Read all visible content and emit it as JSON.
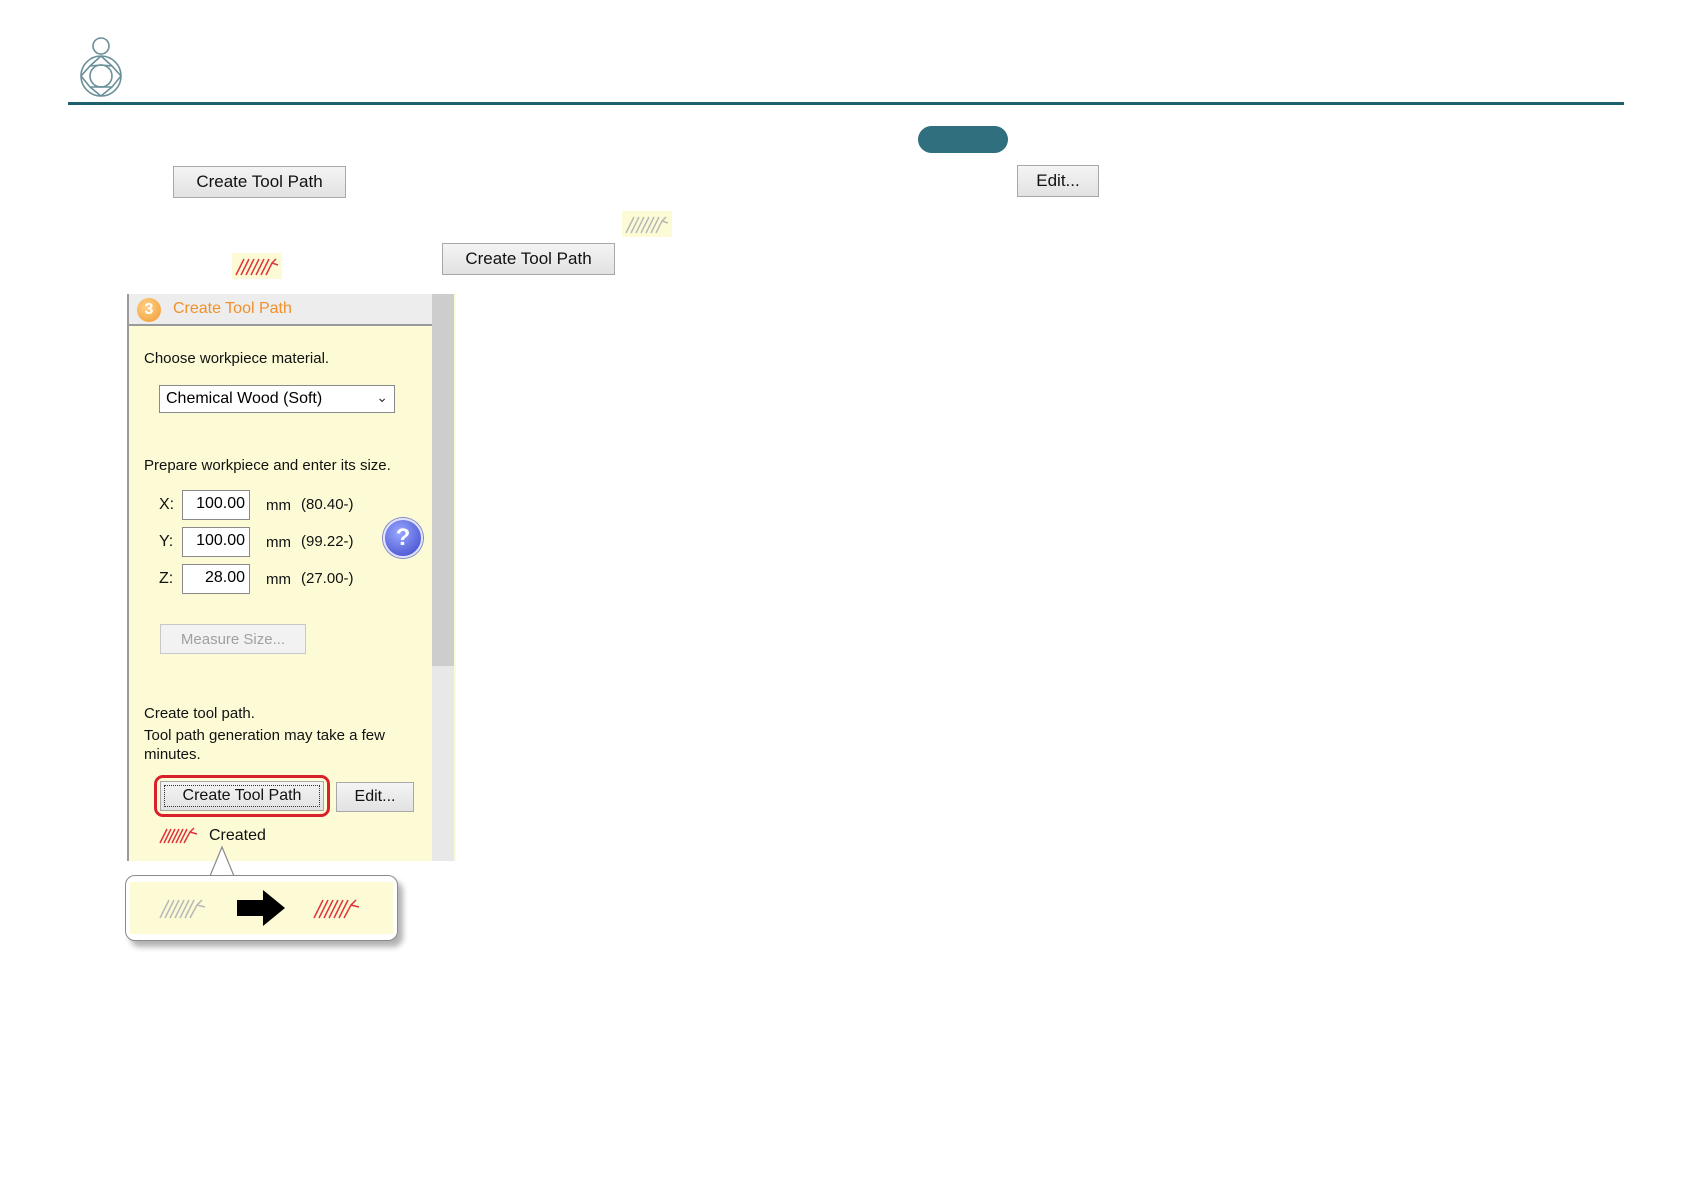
{
  "top_buttons": {
    "create_tool_path_1": "Create Tool Path",
    "edit": "Edit...",
    "create_tool_path_2": "Create Tool Path"
  },
  "panel": {
    "title": "Create Tool Path",
    "step_number": "3",
    "material_prompt": "Choose workpiece material.",
    "material_value": "Chemical Wood (Soft)",
    "size_prompt": "Prepare workpiece and enter its size.",
    "dims": [
      {
        "axis": "X:",
        "value": "100.00",
        "unit": "mm",
        "min": "(80.40-)"
      },
      {
        "axis": "Y:",
        "value": "100.00",
        "unit": "mm",
        "min": "(99.22-)"
      },
      {
        "axis": "Z:",
        "value": "28.00",
        "unit": "mm",
        "min": "(27.00-)"
      }
    ],
    "help_label": "?",
    "measure_button": "Measure Size...",
    "create_prompt_1": "Create tool path.",
    "create_prompt_2": "Tool path generation may take a few minutes.",
    "create_button": "Create Tool Path",
    "edit_button": "Edit...",
    "status": "Created"
  },
  "icons": {
    "logo": "diamond-gem-icon",
    "tool_path_inactive": "tool-path-gray-icon",
    "tool_path_active": "tool-path-red-icon",
    "arrow": "right-arrow-icon"
  },
  "colors": {
    "accent": "#1e5f6e",
    "panel_bg": "#fcfbd6",
    "highlight": "#d8212a",
    "title_orange": "#f0902a"
  }
}
